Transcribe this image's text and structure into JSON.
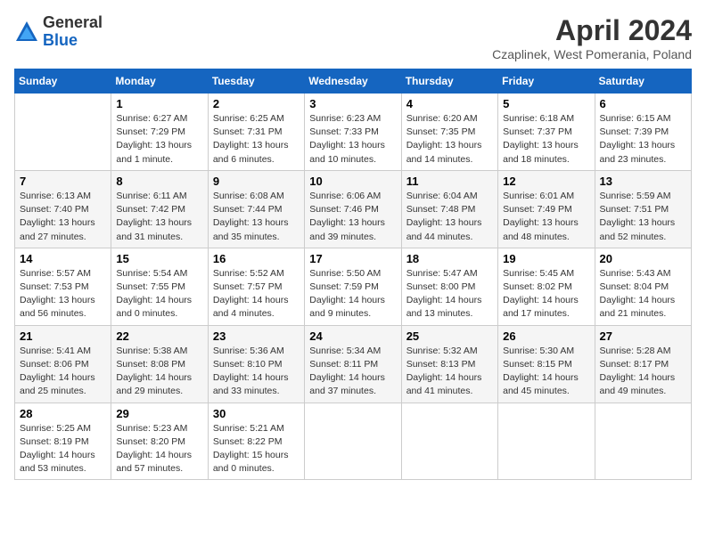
{
  "header": {
    "logo_general": "General",
    "logo_blue": "Blue",
    "month_title": "April 2024",
    "location": "Czaplinek, West Pomerania, Poland"
  },
  "weekdays": [
    "Sunday",
    "Monday",
    "Tuesday",
    "Wednesday",
    "Thursday",
    "Friday",
    "Saturday"
  ],
  "weeks": [
    [
      {
        "day": "",
        "info": ""
      },
      {
        "day": "1",
        "info": "Sunrise: 6:27 AM\nSunset: 7:29 PM\nDaylight: 13 hours\nand 1 minute."
      },
      {
        "day": "2",
        "info": "Sunrise: 6:25 AM\nSunset: 7:31 PM\nDaylight: 13 hours\nand 6 minutes."
      },
      {
        "day": "3",
        "info": "Sunrise: 6:23 AM\nSunset: 7:33 PM\nDaylight: 13 hours\nand 10 minutes."
      },
      {
        "day": "4",
        "info": "Sunrise: 6:20 AM\nSunset: 7:35 PM\nDaylight: 13 hours\nand 14 minutes."
      },
      {
        "day": "5",
        "info": "Sunrise: 6:18 AM\nSunset: 7:37 PM\nDaylight: 13 hours\nand 18 minutes."
      },
      {
        "day": "6",
        "info": "Sunrise: 6:15 AM\nSunset: 7:39 PM\nDaylight: 13 hours\nand 23 minutes."
      }
    ],
    [
      {
        "day": "7",
        "info": "Sunrise: 6:13 AM\nSunset: 7:40 PM\nDaylight: 13 hours\nand 27 minutes."
      },
      {
        "day": "8",
        "info": "Sunrise: 6:11 AM\nSunset: 7:42 PM\nDaylight: 13 hours\nand 31 minutes."
      },
      {
        "day": "9",
        "info": "Sunrise: 6:08 AM\nSunset: 7:44 PM\nDaylight: 13 hours\nand 35 minutes."
      },
      {
        "day": "10",
        "info": "Sunrise: 6:06 AM\nSunset: 7:46 PM\nDaylight: 13 hours\nand 39 minutes."
      },
      {
        "day": "11",
        "info": "Sunrise: 6:04 AM\nSunset: 7:48 PM\nDaylight: 13 hours\nand 44 minutes."
      },
      {
        "day": "12",
        "info": "Sunrise: 6:01 AM\nSunset: 7:49 PM\nDaylight: 13 hours\nand 48 minutes."
      },
      {
        "day": "13",
        "info": "Sunrise: 5:59 AM\nSunset: 7:51 PM\nDaylight: 13 hours\nand 52 minutes."
      }
    ],
    [
      {
        "day": "14",
        "info": "Sunrise: 5:57 AM\nSunset: 7:53 PM\nDaylight: 13 hours\nand 56 minutes."
      },
      {
        "day": "15",
        "info": "Sunrise: 5:54 AM\nSunset: 7:55 PM\nDaylight: 14 hours\nand 0 minutes."
      },
      {
        "day": "16",
        "info": "Sunrise: 5:52 AM\nSunset: 7:57 PM\nDaylight: 14 hours\nand 4 minutes."
      },
      {
        "day": "17",
        "info": "Sunrise: 5:50 AM\nSunset: 7:59 PM\nDaylight: 14 hours\nand 9 minutes."
      },
      {
        "day": "18",
        "info": "Sunrise: 5:47 AM\nSunset: 8:00 PM\nDaylight: 14 hours\nand 13 minutes."
      },
      {
        "day": "19",
        "info": "Sunrise: 5:45 AM\nSunset: 8:02 PM\nDaylight: 14 hours\nand 17 minutes."
      },
      {
        "day": "20",
        "info": "Sunrise: 5:43 AM\nSunset: 8:04 PM\nDaylight: 14 hours\nand 21 minutes."
      }
    ],
    [
      {
        "day": "21",
        "info": "Sunrise: 5:41 AM\nSunset: 8:06 PM\nDaylight: 14 hours\nand 25 minutes."
      },
      {
        "day": "22",
        "info": "Sunrise: 5:38 AM\nSunset: 8:08 PM\nDaylight: 14 hours\nand 29 minutes."
      },
      {
        "day": "23",
        "info": "Sunrise: 5:36 AM\nSunset: 8:10 PM\nDaylight: 14 hours\nand 33 minutes."
      },
      {
        "day": "24",
        "info": "Sunrise: 5:34 AM\nSunset: 8:11 PM\nDaylight: 14 hours\nand 37 minutes."
      },
      {
        "day": "25",
        "info": "Sunrise: 5:32 AM\nSunset: 8:13 PM\nDaylight: 14 hours\nand 41 minutes."
      },
      {
        "day": "26",
        "info": "Sunrise: 5:30 AM\nSunset: 8:15 PM\nDaylight: 14 hours\nand 45 minutes."
      },
      {
        "day": "27",
        "info": "Sunrise: 5:28 AM\nSunset: 8:17 PM\nDaylight: 14 hours\nand 49 minutes."
      }
    ],
    [
      {
        "day": "28",
        "info": "Sunrise: 5:25 AM\nSunset: 8:19 PM\nDaylight: 14 hours\nand 53 minutes."
      },
      {
        "day": "29",
        "info": "Sunrise: 5:23 AM\nSunset: 8:20 PM\nDaylight: 14 hours\nand 57 minutes."
      },
      {
        "day": "30",
        "info": "Sunrise: 5:21 AM\nSunset: 8:22 PM\nDaylight: 15 hours\nand 0 minutes."
      },
      {
        "day": "",
        "info": ""
      },
      {
        "day": "",
        "info": ""
      },
      {
        "day": "",
        "info": ""
      },
      {
        "day": "",
        "info": ""
      }
    ]
  ]
}
